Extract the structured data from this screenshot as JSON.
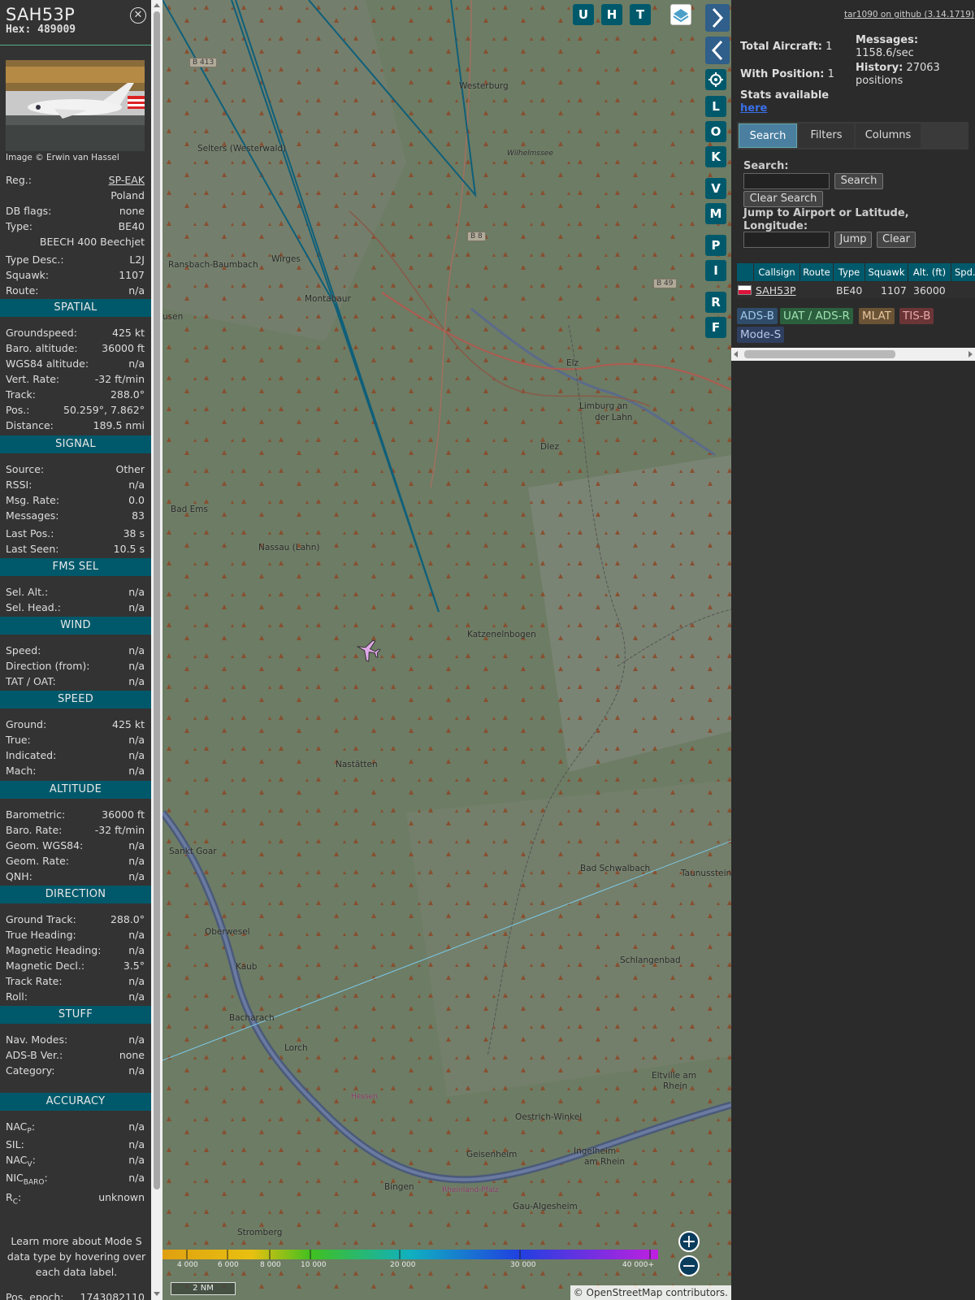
{
  "aircraft": {
    "callsign": "SAH53P",
    "hex_label": "Hex:",
    "hex": "489009",
    "photo_credit": "Image © Erwin van Hassel",
    "close_icon": "close-circle-icon"
  },
  "basic": [
    {
      "k": "Reg.:",
      "v": "SP-EAK"
    },
    {
      "k": "",
      "v": "Poland"
    },
    {
      "k": "DB flags:",
      "v": "none"
    },
    {
      "k": "Type:",
      "v": "BE40"
    },
    {
      "k": "",
      "v": "BEECH 400 Beechjet"
    },
    {
      "k": "Type Desc.:",
      "v": "L2J"
    },
    {
      "k": "Squawk:",
      "v": "1107"
    },
    {
      "k": "Route:",
      "v": "n/a"
    }
  ],
  "sections": {
    "spatial": {
      "title": "SPATIAL",
      "rows": [
        {
          "k": "Groundspeed:",
          "v": "425 kt"
        },
        {
          "k": "Baro. altitude:",
          "v": "36000 ft"
        },
        {
          "k": "WGS84 altitude:",
          "v": "n/a"
        },
        {
          "k": "Vert. Rate:",
          "v": "-32 ft/min"
        },
        {
          "k": "Track:",
          "v": "288.0°"
        },
        {
          "k": "Pos.:",
          "v": "50.259°, 7.862°"
        },
        {
          "k": "Distance:",
          "v": "189.5 nmi"
        }
      ]
    },
    "signal": {
      "title": "SIGNAL",
      "rows": [
        {
          "k": "Source:",
          "v": "Other"
        },
        {
          "k": "RSSI:",
          "v": "n/a"
        },
        {
          "k": "Msg. Rate:",
          "v": "0.0"
        },
        {
          "k": "Messages:",
          "v": "83"
        },
        {
          "k": "Last Pos.:",
          "v": "38 s"
        },
        {
          "k": "Last Seen:",
          "v": "10.5 s"
        }
      ]
    },
    "fms": {
      "title": "FMS SEL",
      "rows": [
        {
          "k": "Sel. Alt.:",
          "v": "n/a"
        },
        {
          "k": "Sel. Head.:",
          "v": "n/a"
        }
      ]
    },
    "wind": {
      "title": "WIND",
      "rows": [
        {
          "k": "Speed:",
          "v": "n/a"
        },
        {
          "k": "Direction (from):",
          "v": "n/a"
        },
        {
          "k": "TAT / OAT:",
          "v": "n/a"
        }
      ]
    },
    "speed": {
      "title": "SPEED",
      "rows": [
        {
          "k": "Ground:",
          "v": "425 kt"
        },
        {
          "k": "True:",
          "v": "n/a"
        },
        {
          "k": "Indicated:",
          "v": "n/a"
        },
        {
          "k": "Mach:",
          "v": "n/a"
        }
      ]
    },
    "altitude": {
      "title": "ALTITUDE",
      "rows": [
        {
          "k": "Barometric:",
          "v": "36000 ft"
        },
        {
          "k": "Baro. Rate:",
          "v": "-32 ft/min"
        },
        {
          "k": "Geom. WGS84:",
          "v": "n/a"
        },
        {
          "k": "Geom. Rate:",
          "v": "n/a"
        },
        {
          "k": "QNH:",
          "v": "n/a"
        }
      ]
    },
    "direction": {
      "title": "DIRECTION",
      "rows": [
        {
          "k": "Ground Track:",
          "v": "288.0°"
        },
        {
          "k": "True Heading:",
          "v": "n/a"
        },
        {
          "k": "Magnetic Heading:",
          "v": "n/a"
        },
        {
          "k": "Magnetic Decl.:",
          "v": "3.5°"
        },
        {
          "k": "Track Rate:",
          "v": "n/a"
        },
        {
          "k": "Roll:",
          "v": "n/a"
        }
      ]
    },
    "stuff": {
      "title": "STUFF",
      "rows": [
        {
          "k": "Nav. Modes:",
          "v": "n/a"
        },
        {
          "k": "ADS-B Ver.:",
          "v": "none"
        },
        {
          "k": "Category:",
          "v": "n/a"
        }
      ]
    },
    "accuracy": {
      "title": "ACCURACY",
      "rows": [
        {
          "k": "NAC",
          "sub": "P",
          "v": "n/a"
        },
        {
          "k": "SIL:",
          "v": "n/a"
        },
        {
          "k": "NAC",
          "sub": "V",
          "v": "n/a"
        },
        {
          "k": "NIC",
          "sub": "BARO",
          "v": "n/a"
        },
        {
          "k": "R",
          "sub": "C",
          "v": "unknown"
        }
      ]
    }
  },
  "learn_more": "Learn more about Mode S data type by hovering over each data label.",
  "pos_epoch": {
    "k": "Pos. epoch:",
    "v": "1743082110"
  },
  "map": {
    "towns": [
      {
        "n": "Westerburg"
      },
      {
        "n": "Selters (Westerwald)"
      },
      {
        "n": "Wilhelmssee"
      },
      {
        "n": "Ransbach-Baumbach"
      },
      {
        "n": "Wirges"
      },
      {
        "n": "Montabaur"
      },
      {
        "n": "usen"
      },
      {
        "n": "Elz"
      },
      {
        "n": "Limburg an"
      },
      {
        "n": "der Lahn"
      },
      {
        "n": "Diez"
      },
      {
        "n": "Bad Ems"
      },
      {
        "n": "Nassau (Lahn)"
      },
      {
        "n": "Katzenelnbogen"
      },
      {
        "n": "Nastätten"
      },
      {
        "n": "Sankt Goar"
      },
      {
        "n": "Bad Schwalbach"
      },
      {
        "n": "Taunusstein"
      },
      {
        "n": "Oberwesel"
      },
      {
        "n": "Kaub"
      },
      {
        "n": "Schlangenbad"
      },
      {
        "n": "Bacharach"
      },
      {
        "n": "Lorch"
      },
      {
        "n": "Eltville am"
      },
      {
        "n": "Rhein"
      },
      {
        "n": "Oestrich-Winkel"
      },
      {
        "n": "Geisenheim"
      },
      {
        "n": "Ingelheim"
      },
      {
        "n": "am Rhein"
      },
      {
        "n": "Bingen"
      },
      {
        "n": "Gau-Algesheim"
      },
      {
        "n": "Stromberg"
      },
      {
        "n": "Hessen"
      },
      {
        "n": "Rheinland-Pfalz"
      }
    ],
    "roads": [
      "B 413",
      "B 8",
      "B 49"
    ],
    "buttons": [
      "U",
      "H",
      "T"
    ],
    "side_buttons": [
      "L",
      "O",
      "K",
      "V",
      "M",
      "P",
      "I",
      "R",
      "F"
    ],
    "scale_label": "2 NM",
    "attribution_prefix": "© ",
    "attribution_link": "OpenStreetMap",
    "attribution_suffix": " contributors.",
    "altitude_ticks": [
      "4 000",
      "6 000",
      "8 000",
      "10 000",
      "20 000",
      "30 000",
      "40 000+"
    ],
    "zoom_in": "+",
    "zoom_out": "−"
  },
  "panel": {
    "github_link": "tar1090 on github (3.14.1719)",
    "total_aircraft_label": "Total Aircraft:",
    "total_aircraft": "1",
    "with_position_label": "With Position:",
    "with_position": "1",
    "messages_label": "Messages:",
    "messages": "1158.6/sec",
    "history_label": "History:",
    "history": "27063 positions",
    "stats_label": "Stats available",
    "stats_link": "here",
    "tabs": [
      "Search",
      "Filters",
      "Columns"
    ],
    "search_label": "Search:",
    "search_button": "Search",
    "clear_search_button": "Clear Search",
    "jump_label": "Jump to Airport or Latitude, Longitude:",
    "jump_button": "Jump",
    "clear_button": "Clear",
    "table": {
      "columns": [
        "Callsign",
        "Route",
        "Type",
        "Squawk",
        "Alt. (ft)",
        "Spd."
      ],
      "row": {
        "callsign": "SAH53P",
        "route": "",
        "type": "BE40",
        "squawk": "1107",
        "alt": "36000"
      }
    },
    "legend": [
      "ADS-B",
      "UAT / ADS-R",
      "MLAT",
      "TIS-B",
      "Mode-S"
    ]
  },
  "colors": {
    "section_bg": "#00596b",
    "adsb": "#2f4d6b",
    "uat": "#2b5f3e",
    "mlat": "#6b5335",
    "tisb": "#6b3537",
    "modes": "#2f3f5f"
  }
}
